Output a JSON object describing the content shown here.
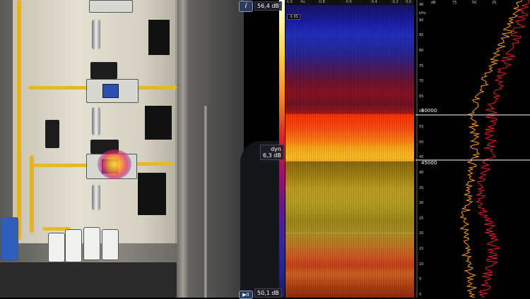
{
  "camera": {
    "info_icon": "info-icon",
    "play_icon": "play-pause-icon",
    "info_glyph": "i",
    "play_glyph": "▶II"
  },
  "scale": {
    "max": "56,4 dB",
    "dyn_label": "dyn",
    "dyn_value": "6,3 dB",
    "min": "50,1 dB"
  },
  "spectrogram": {
    "top_axis": [
      "-1.0",
      "-5s",
      "-0.8",
      "-0.6",
      "-0.4",
      "-0.2",
      "0.0"
    ],
    "tag": "-1.01"
  },
  "profile": {
    "top_axis": [
      "dB",
      "75",
      "50",
      "25"
    ],
    "unit": "kHz",
    "freq_ticks": [
      "96",
      "90",
      "85",
      "80",
      "75",
      "70",
      "65",
      "60",
      "55",
      "50",
      "45",
      "40",
      "35",
      "30",
      "25",
      "20",
      "15",
      "10",
      "5",
      "0"
    ],
    "band_upper": "60000",
    "band_lower": "45000"
  },
  "colors": {
    "hose": "#e8b91f",
    "band_line": "#ffffff",
    "trace_orange": "#ff9a1e",
    "trace_red": "#e0202a"
  }
}
